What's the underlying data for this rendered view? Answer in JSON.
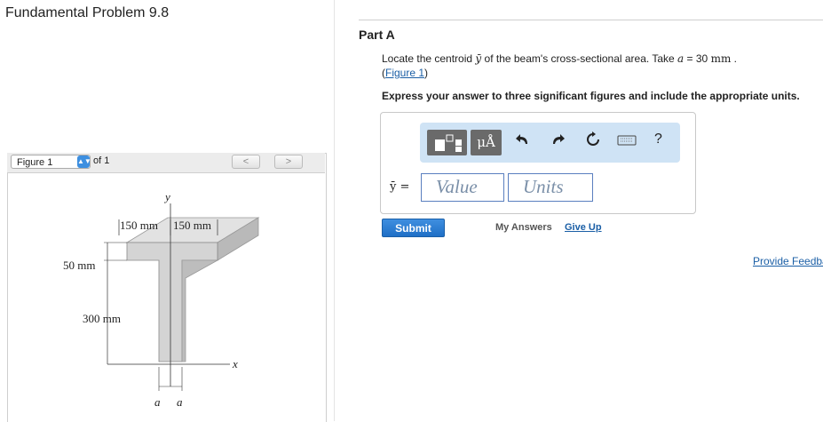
{
  "problem": {
    "title": "Fundamental Problem 9.8"
  },
  "part": {
    "title": "Part A",
    "question_prefix": "Locate the centroid ",
    "question_var": "ȳ",
    "question_mid": " of the beam's cross-sectional area. Take ",
    "question_a": "a",
    "question_eq": " = 30 ",
    "question_unit": "mm",
    "question_end": " .",
    "figure_link": "Figure 1",
    "instruction": "Express your answer to three significant figures and include the appropriate units."
  },
  "toolbar": {
    "units_label": "μÅ",
    "help_label": "?"
  },
  "answer": {
    "var_label": "ȳ =",
    "value_placeholder": "Value",
    "units_placeholder": "Units"
  },
  "actions": {
    "submit": "Submit",
    "my_answers": "My Answers",
    "give_up": "Give Up",
    "feedback": "Provide Feedback"
  },
  "figure_nav": {
    "selected": "Figure 1",
    "of_label": "of 1",
    "prev": "<",
    "next": ">"
  },
  "figure": {
    "axis_y": "y",
    "axis_x": "x",
    "dim_left": "150 mm",
    "dim_right": "150 mm",
    "dim_flange": "50 mm",
    "dim_web": "300 mm",
    "dim_a1": "a",
    "dim_a2": "a"
  },
  "colors": {
    "accent": "#1f6fc6",
    "toolbar_bg": "#cfe3f5",
    "link": "#1b5fa6",
    "beam_face": "#dcdcdc",
    "beam_side": "#bdbdbd"
  }
}
